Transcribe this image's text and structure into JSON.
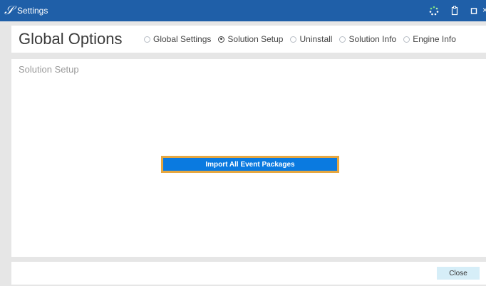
{
  "window": {
    "title": "Settings",
    "logo_glyph": "𝒮"
  },
  "header": {
    "title": "Global Options",
    "tabs": [
      {
        "label": "Global Settings",
        "selected": false
      },
      {
        "label": "Solution Setup",
        "selected": true
      },
      {
        "label": "Uninstall",
        "selected": false
      },
      {
        "label": "Solution Info",
        "selected": false
      },
      {
        "label": "Engine Info",
        "selected": false
      }
    ]
  },
  "content": {
    "section_title": "Solution Setup",
    "import_button_label": "Import All Event Packages"
  },
  "footer": {
    "close_label": "Close"
  },
  "colors": {
    "titlebar": "#1f5fa8",
    "primary_button": "#0a7ae0",
    "focus_border": "#e6a740",
    "secondary_button": "#d6eef8"
  },
  "icons": [
    "app-logo-icon",
    "spinner-icon",
    "clipboard-icon",
    "maximize-icon",
    "close-icon"
  ]
}
